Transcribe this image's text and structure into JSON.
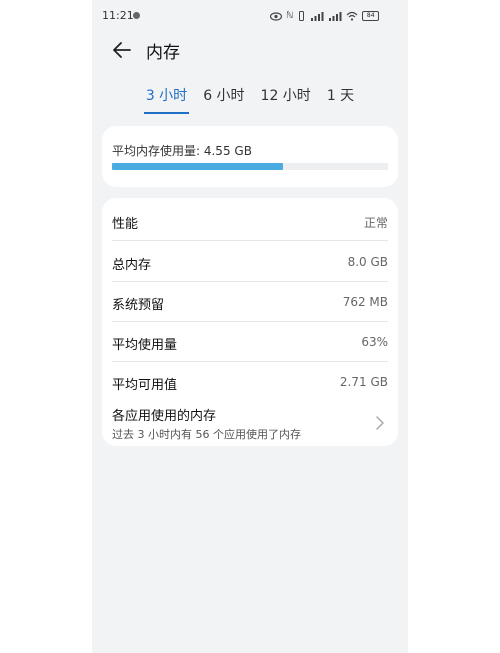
{
  "status_bar": {
    "time": "11:21",
    "icons": [
      "eye-icon",
      "nfc-icon",
      "vibrate-icon",
      "signal-icon",
      "signal-icon",
      "wifi-icon",
      "battery-icon"
    ],
    "battery": "84"
  },
  "header": {
    "title": "内存"
  },
  "tabs": [
    {
      "label": "3 小时",
      "active": true
    },
    {
      "label": "6 小时",
      "active": false
    },
    {
      "label": "12 小时",
      "active": false
    },
    {
      "label": "1 天",
      "active": false
    }
  ],
  "usage": {
    "label": "平均内存使用量:  4.55 GB",
    "fill_fraction": 0.62,
    "bar_color": "#4aabe0"
  },
  "rows": [
    {
      "label": "性能",
      "value": "正常"
    },
    {
      "label": "总内存",
      "value": "8.0 GB"
    },
    {
      "label": "系统预留",
      "value": "762 MB"
    },
    {
      "label": "平均使用量",
      "value": "63%"
    },
    {
      "label": "平均可用值",
      "value": "2.71 GB"
    }
  ],
  "apps": {
    "title": "各应用使用的内存",
    "subtitle": "过去 3 小时内有 56 个应用使用了内存"
  },
  "accent_color": "#1f6fc5"
}
